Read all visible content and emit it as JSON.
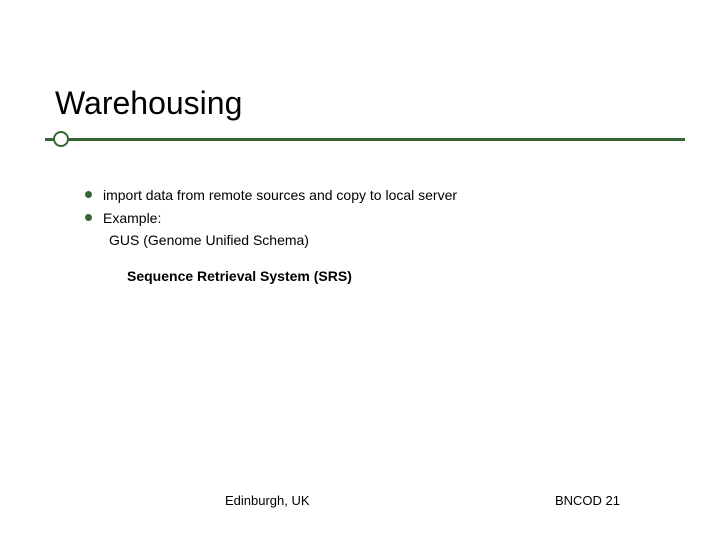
{
  "title": "Warehousing",
  "bullets": [
    "import data from remote sources and copy to local server",
    "Example:"
  ],
  "example_item": "GUS (Genome Unified Schema)",
  "secondary_item": "Sequence Retrieval System (SRS)",
  "footer": {
    "left": "Edinburgh, UK",
    "right": "BNCOD 21"
  }
}
